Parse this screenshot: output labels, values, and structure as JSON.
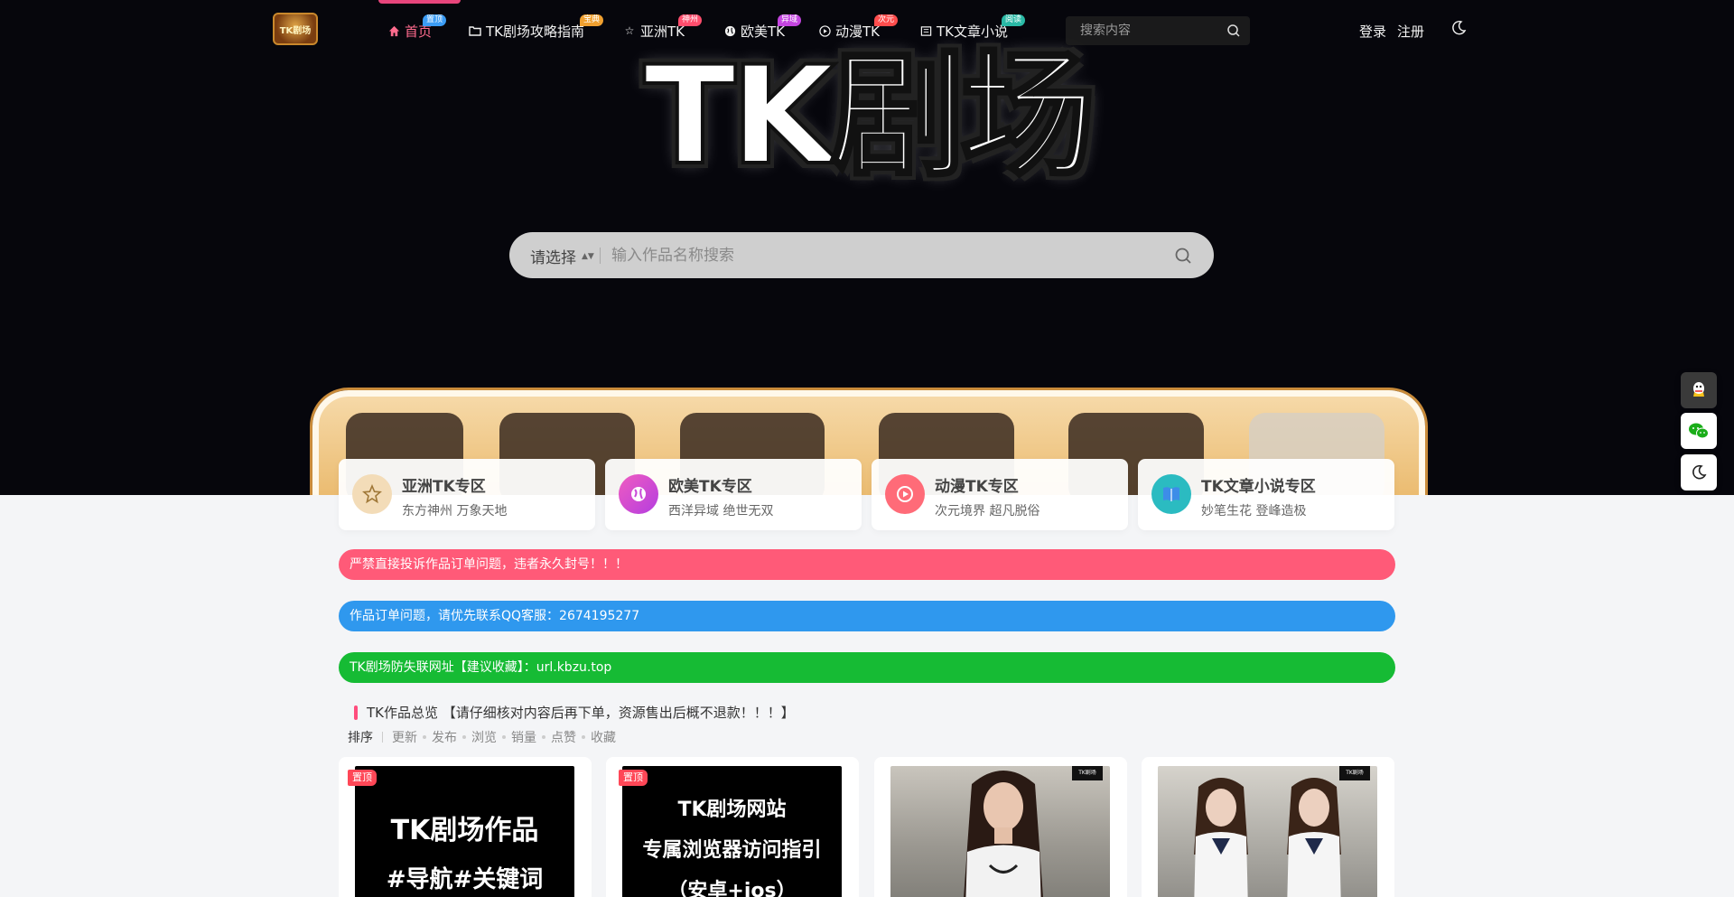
{
  "brand": {
    "logo_text": "TK剧场",
    "hero_title": "TK剧场"
  },
  "nav": {
    "items": [
      {
        "label": "首页",
        "badge": "置顶",
        "badge_color": "#3b9cf5",
        "icon": "home-icon"
      },
      {
        "label": "TK剧场攻略指南",
        "badge": "宝典",
        "badge_color": "#f0a030",
        "icon": "folder-icon"
      },
      {
        "label": "亚洲TK",
        "badge": "神州",
        "badge_color": "#ff4d6d",
        "icon": "star-icon"
      },
      {
        "label": "欧美TK",
        "badge": "异域",
        "badge_color": "#c445e0",
        "icon": "globe-icon"
      },
      {
        "label": "动漫TK",
        "badge": "次元",
        "badge_color": "#ff4d4d",
        "icon": "play-icon"
      },
      {
        "label": "TK文章小说",
        "badge": "阅读",
        "badge_color": "#2ab9a6",
        "icon": "book-icon"
      }
    ],
    "search_placeholder": "搜索内容",
    "login": "登录",
    "register": "注册"
  },
  "hero_search": {
    "select_label": "请选择",
    "placeholder": "输入作品名称搜索"
  },
  "categories": [
    {
      "title": "亚洲TK专区",
      "subtitle": "东方神州 万象天地",
      "icon": "star-icon",
      "color": "#e9c79a"
    },
    {
      "title": "欧美TK专区",
      "subtitle": "西洋异域 绝世无双",
      "icon": "globe-icon",
      "color": "#d94fe0"
    },
    {
      "title": "动漫TK专区",
      "subtitle": "次元境界 超凡脱俗",
      "icon": "play-icon",
      "color": "#ff6b78"
    },
    {
      "title": "TK文章小说专区",
      "subtitle": "妙笔生花 登峰造极",
      "icon": "book-icon",
      "color": "#2bbbc1"
    }
  ],
  "notices": [
    {
      "text": "严禁直接投诉作品订单问题，违者永久封号！！！",
      "color": "#ff5a78"
    },
    {
      "text": "作品订单问题，请优先联系QQ客服：2674195277",
      "color": "#2f98ee"
    },
    {
      "text": "TK剧场防失联网址【建议收藏】：url.kbzu.top",
      "color": "#16bb34"
    }
  ],
  "section": {
    "title": "TK作品总览 【请仔细核对内容后再下单，资源售出后概不退款！！！】",
    "sort_label": "排序",
    "sort_options": [
      "更新",
      "发布",
      "浏览",
      "销量",
      "点赞",
      "收藏"
    ]
  },
  "cards": [
    {
      "tag": "置顶",
      "lines": [
        "TK剧场作品",
        "#导航#关键词"
      ]
    },
    {
      "tag": "置顶",
      "lines": [
        "TK剧场网站",
        "专属浏览器访问指引",
        "（安卓+ios）"
      ]
    },
    {
      "tag": "",
      "watermark": "TK剧场"
    },
    {
      "tag": "",
      "watermark": "TK剧场"
    }
  ],
  "float_buttons": [
    "qq-icon",
    "wechat-icon",
    "moon-icon"
  ]
}
